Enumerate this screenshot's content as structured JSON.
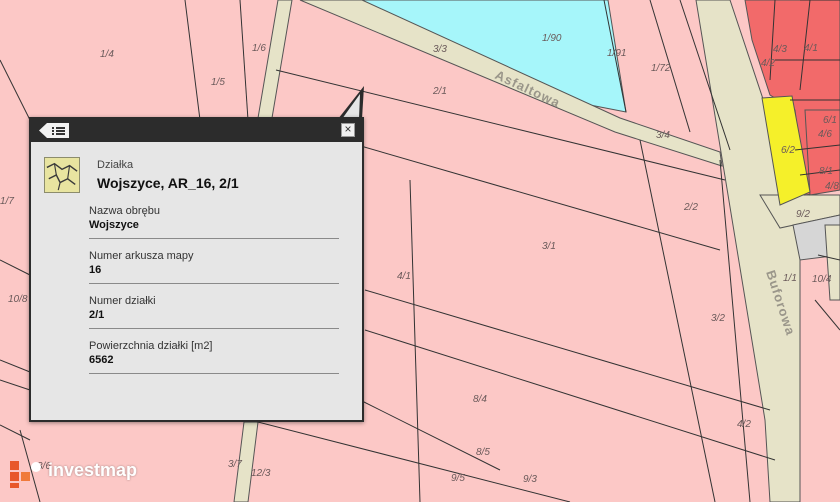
{
  "map": {
    "street_labels": [
      "Asfaltowa",
      "Buforowa"
    ],
    "parcel_labels": [
      "1/4",
      "1/6",
      "1/5",
      "3/3",
      "1/90",
      "1/91",
      "1/72",
      "2/1",
      "4/3",
      "4/2",
      "4/1",
      "6/1",
      "4/6",
      "6/2",
      "8/1",
      "4/8",
      "9/2",
      "3/4",
      "2/2",
      "3/1",
      "4/1",
      "1/1",
      "10/4",
      "3/2",
      "8/4",
      "4/2",
      "8/5",
      "9/3",
      "9/5",
      "12/3",
      "3/7",
      "1/7",
      "10/8",
      "3/6"
    ],
    "colors": {
      "parcel": "#fcc8c6",
      "road": "#e6e3c8",
      "water": "#a6f6fa",
      "built": "#f26a6a",
      "yellow": "#f5f02a",
      "gray": "#d6d6d6"
    }
  },
  "popup": {
    "type_label": "Działka",
    "title": "Wojszyce, AR_16, 2/1",
    "close_symbol": "×",
    "fields": [
      {
        "key": "Nazwa obrębu",
        "value": "Wojszyce"
      },
      {
        "key": "Numer arkusza mapy",
        "value": "16"
      },
      {
        "key": "Numer działki",
        "value": "2/1"
      },
      {
        "key": "Powierzchnia działki [m2]",
        "value": "6562"
      }
    ]
  },
  "logo": {
    "text": "investmap",
    "colors": [
      "#e8572a",
      "#f07a3a"
    ]
  }
}
